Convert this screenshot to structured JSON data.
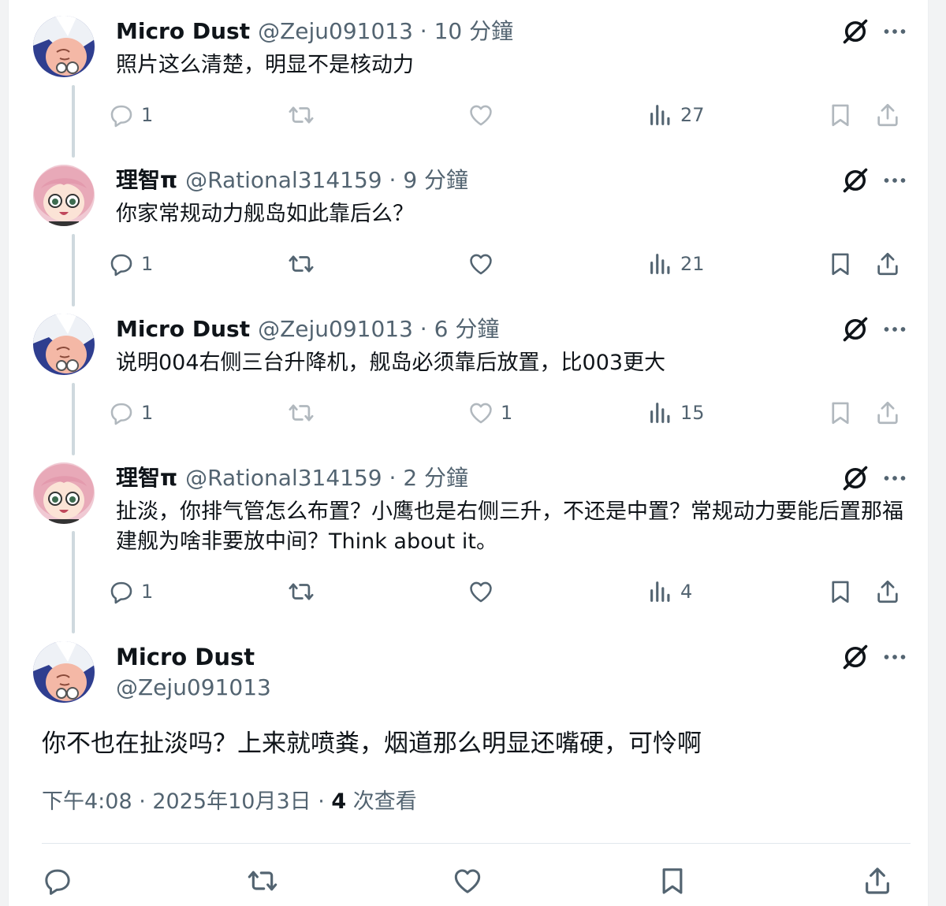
{
  "replies": [
    {
      "name": "Micro Dust",
      "meta": "@Zeju091013 · 10 分鐘",
      "text": "照片这么清楚，明显不是核动力",
      "avatar": "cartoon-face-avatar",
      "counts": {
        "reply": "1",
        "retweet": "",
        "like": "",
        "views": "27"
      }
    },
    {
      "name": "理智π",
      "meta": "@Rational314159 · 9 分鐘",
      "text": "你家常规动力舰岛如此靠后么？",
      "avatar": "anime-girl-avatar",
      "counts": {
        "reply": "1",
        "retweet": "",
        "like": "",
        "views": "21"
      }
    },
    {
      "name": "Micro Dust",
      "meta": "@Zeju091013 · 6 分鐘",
      "text": "说明004右侧三台升降机，舰岛必须靠后放置，比003更大",
      "avatar": "cartoon-face-avatar",
      "counts": {
        "reply": "1",
        "retweet": "",
        "like": "1",
        "views": "15"
      }
    },
    {
      "name": "理智π",
      "meta": "@Rational314159 · 2 分鐘",
      "text": "扯淡，你排气管怎么布置？小鹰也是右侧三升，不还是中置？常规动力要能后置那福建舰为啥非要放中间？Think about it。",
      "avatar": "anime-girl-avatar",
      "counts": {
        "reply": "1",
        "retweet": "",
        "like": "",
        "views": "4"
      }
    }
  ],
  "main_post": {
    "name": "Micro Dust",
    "handle": "@Zeju091013",
    "text": "你不也在扯淡吗？上来就喷粪，烟道那么明显还嘴硬，可怜啊",
    "time": "下午4:08 · 2025年10月3日 · ",
    "views_count": "4",
    "views_label": " 次查看"
  },
  "icons": {
    "reply": "reply-icon",
    "retweet": "retweet-icon",
    "like": "heart-icon",
    "views": "views-icon",
    "bookmark": "bookmark-icon",
    "share": "share-icon",
    "grok": "grok-icon",
    "more": "more-icon"
  },
  "colors": {
    "text": "#0f1419",
    "secondary": "#536471",
    "thread_line": "#cfd9de"
  }
}
